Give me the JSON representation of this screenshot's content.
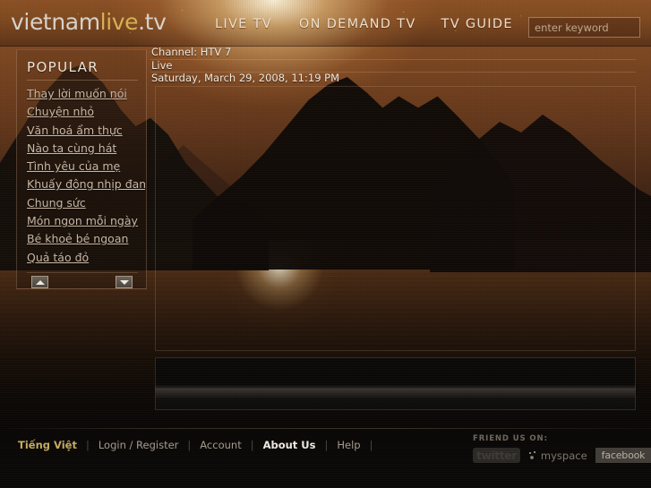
{
  "brand": {
    "part1": "vietnam",
    "part2": "live",
    "part3": ".tv",
    "colors": {
      "light": "#d9d4cc",
      "gold": "#d8b253",
      "header_base": "#80491f"
    }
  },
  "nav": {
    "items": [
      {
        "label": "LIVE TV",
        "name": "nav-live-tv"
      },
      {
        "label": "ON DEMAND TV",
        "name": "nav-on-demand-tv"
      },
      {
        "label": "TV GUIDE",
        "name": "nav-tv-guide"
      }
    ]
  },
  "search": {
    "placeholder": "enter keyword",
    "value": "",
    "submit_icon": "play-triangle-icon"
  },
  "sidebar": {
    "title": "POPULAR",
    "items": [
      {
        "label": "Thay lời muốn nói"
      },
      {
        "label": "Chuyện nhỏ"
      },
      {
        "label": "Văn hoá ẩm thực"
      },
      {
        "label": "Nào ta cùng hát"
      },
      {
        "label": "Tình yêu của mẹ"
      },
      {
        "label": "Khuấy động nhịp đam mê"
      },
      {
        "label": "Chung sức"
      },
      {
        "label": "Món ngon mỗi ngày"
      },
      {
        "label": "Bé khoẻ bé ngoan"
      },
      {
        "label": "Quả táo đỏ"
      }
    ],
    "scroll_up_icon": "arrow-up-icon",
    "scroll_down_icon": "arrow-down-icon"
  },
  "player": {
    "channel": "Channel: HTV 7",
    "status": "Live",
    "timestamp": "Saturday, March 29, 2008, 11:19 PM"
  },
  "footer": {
    "links": [
      {
        "label": "Tiếng Việt",
        "style": "gold"
      },
      {
        "label": "Login / Register",
        "style": "normal"
      },
      {
        "label": "Account",
        "style": "normal"
      },
      {
        "label": "About Us",
        "style": "current"
      },
      {
        "label": "Help",
        "style": "normal"
      }
    ],
    "social_caption": "FRIEND US ON:",
    "social": [
      {
        "label": "twitter",
        "name": "twitter-logo"
      },
      {
        "label": "myspace",
        "name": "myspace-logo"
      },
      {
        "label": "facebook",
        "name": "facebook-logo"
      }
    ]
  }
}
